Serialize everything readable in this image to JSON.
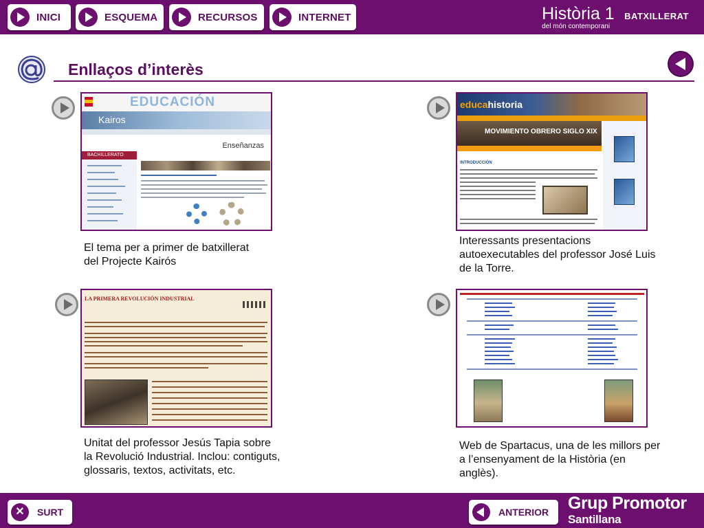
{
  "nav": {
    "items": [
      {
        "label": "INICI"
      },
      {
        "label": "ESQUEMA"
      },
      {
        "label": "RECURSOS"
      },
      {
        "label": "INTERNET"
      }
    ]
  },
  "brand": {
    "title": "Història 1",
    "level": "BATXILLERAT",
    "subtitle": "del món contemporani"
  },
  "page": {
    "title": "Enllaços d’interès"
  },
  "links": [
    {
      "thumbnail_heading": "EDUCACIÓN",
      "thumbnail_banner": "Kairos",
      "thumbnail_section": "Enseñanzas",
      "thumbnail_menu": "BACHILLERATO",
      "description_lines": [
        "El tema per a primer de batxillerat",
        "del Projecte Kairós"
      ]
    },
    {
      "thumbnail_logo_a": "educa",
      "thumbnail_logo_b": "historia",
      "thumbnail_heading": "MOVIMIENTO OBRERO SIGLO XIX",
      "thumbnail_intro": "INTRODUCCIÓN",
      "description_lines": [
        "Interessants presentacions",
        "autoexecutables del professor José Luis",
        "de la Torre."
      ]
    },
    {
      "thumbnail_heading": "LA PRIMERA REVOLUCIÓN INDUSTRIAL",
      "description_lines": [
        "Unitat del professor Jesús Tapia sobre",
        "la Revolució Industrial. Inclou: contiguts,",
        "glossaris, textos, activitats, etc."
      ]
    },
    {
      "description_lines": [
        "Web de Spartacus, una de les millors per",
        "a l’ensenyament de la Història (en",
        "anglès)."
      ]
    }
  ],
  "footer": {
    "exit_label": "SURT",
    "prev_label": "ANTERIOR",
    "publisher_line1": "Grup Promotor",
    "publisher_line2": "Santillana"
  },
  "colors": {
    "brand_purple": "#6c0f6e",
    "button_grey": "#d9d9d9"
  },
  "icons": {
    "nav_button_icon": "play-icon",
    "link_icon": "play-icon",
    "page_icon": "at-sign-icon",
    "back_icon": "back-arrow-icon",
    "exit_icon": "close-icon"
  }
}
